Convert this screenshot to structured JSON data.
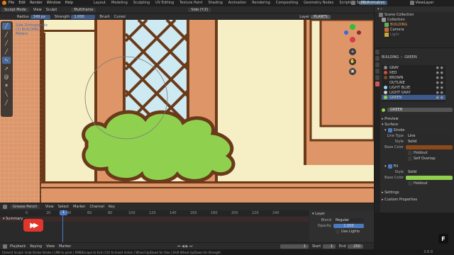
{
  "menubar": {
    "items": [
      "File",
      "Edit",
      "Render",
      "Window",
      "Help"
    ],
    "workspaces": [
      "Layout",
      "Modeling",
      "Sculpting",
      "UV Editing",
      "Texture Paint",
      "Shading",
      "Animation",
      "Rendering",
      "Compositing",
      "Geometry Nodes",
      "Scripting",
      "2D Animation"
    ],
    "active_workspace": "2D Animation",
    "scene": "Scene",
    "view_layer": "ViewLayer"
  },
  "header": {
    "mode": "Sculpt Mode",
    "view": "View",
    "sculpt": "Sculpt",
    "multiframe": "Multiframe",
    "object_select": "Side (Y-Z)"
  },
  "tooltool": {
    "radius_label": "Radius",
    "radius_val": "349 px",
    "strength_label": "Strength",
    "strength_val": "1.000",
    "brush": "Brush",
    "cursor": "Cursor",
    "layer_label": "Layer",
    "layer_val": "PLANTS"
  },
  "overlay_text": [
    "Side Orthographic",
    "(1) BUILDING",
    "Meters"
  ],
  "outliner": {
    "items": [
      "Scene Collection",
      "Collection",
      "BUILDING",
      "Camera",
      "Light"
    ]
  },
  "props": {
    "breadcrumb_a": "BUILDING",
    "breadcrumb_b": "GREEN",
    "layers": [
      {
        "name": "GRAY",
        "color": "#888888"
      },
      {
        "name": "RED",
        "color": "#d94a3a"
      },
      {
        "name": "BROWN",
        "color": "#7a4a28"
      },
      {
        "name": "OUTLINE",
        "color": "#222222"
      },
      {
        "name": "LIGHT BLUE",
        "color": "#9ad4f0"
      },
      {
        "name": "LIGHT GRAY",
        "color": "#cccccc"
      },
      {
        "name": "GREEN",
        "color": "#8fd14f"
      }
    ],
    "material_name": "GREEN",
    "preview": "Preview",
    "surface": "Surface",
    "stroke": "Stroke",
    "line_type_label": "Line Type",
    "line_type": "Line",
    "style_label": "Style",
    "style": "Solid",
    "base_color_label": "Base Color",
    "stroke_color": "#8a4a1a",
    "holdout": "Holdout",
    "self_overlap": "Self Overlap",
    "fill": "Fill",
    "fill_style": "Solid",
    "fill_color": "#8fd14f",
    "fill_holdout": "Holdout",
    "settings": "Settings",
    "custom": "Custom Properties"
  },
  "timeline": {
    "editor": "Grease Pencil",
    "menu": [
      "View",
      "Select",
      "Marker",
      "Channel",
      "Key"
    ],
    "summary": "Summary",
    "ticks": [
      "0",
      "20",
      "40",
      "60",
      "80",
      "100",
      "120",
      "140",
      "160",
      "180",
      "200",
      "220",
      "240"
    ],
    "current_frame": "1",
    "layer_panel": "Layer",
    "blend_label": "Blend",
    "blend": "Regular",
    "opacity_label": "Opacity",
    "opacity": "1.000",
    "use_lights": "Use Lights"
  },
  "playback": {
    "items": [
      "Playback",
      "Keying",
      "View",
      "Marker"
    ],
    "frame": "1",
    "start_label": "Start",
    "start": "1",
    "end_label": "End",
    "end": "250"
  },
  "status": {
    "hint": "[Select] Sculpt: Grab Stroke Stroke  | LMB to paint | RMB/Escape to Exit | Ctrl to Invert Action | Wheel Up/Down for Size | Shift Wheel Up/Down for Strength",
    "version": "3.6.0"
  }
}
